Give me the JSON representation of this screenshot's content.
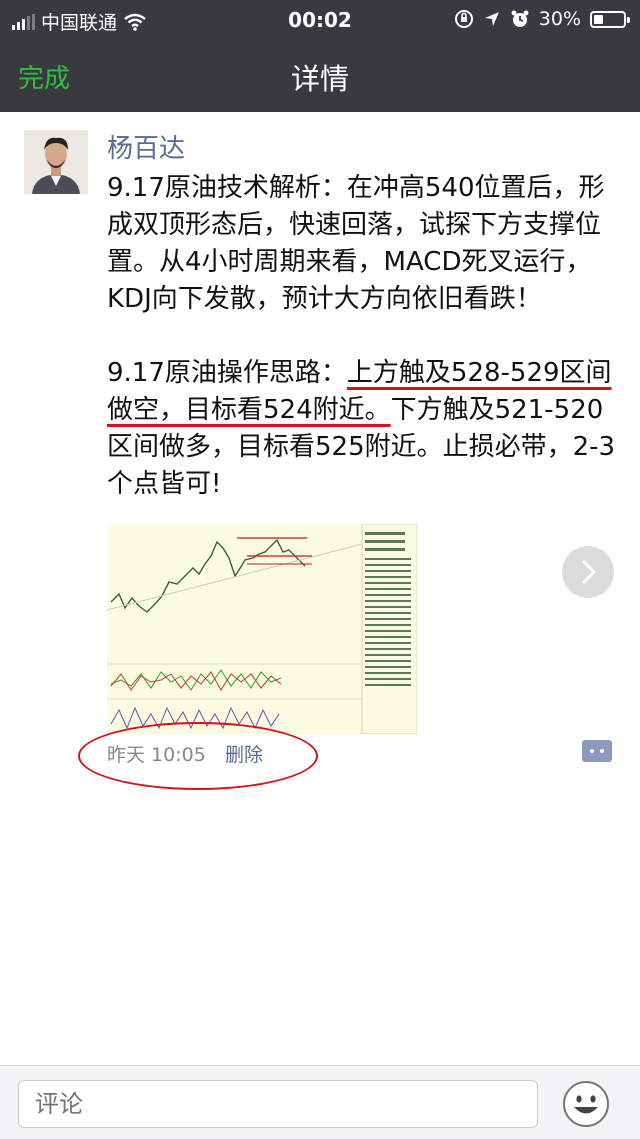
{
  "status_bar": {
    "carrier": "中国联通",
    "time": "00:02",
    "battery": "30%",
    "battery_level": 0.3
  },
  "nav": {
    "done_label": "完成",
    "title": "详情"
  },
  "post": {
    "author": "杨百达",
    "paragraph1": "9.17原油技术解析：在冲高540位置后，形成双顶形态后，快速回落，试探下方支撑位置。从4小时周期来看，MACD死叉运行，KDJ向下发散，预计大方向依旧看跌！",
    "paragraph2_prefix": "9.17原油操作思路：",
    "paragraph2_underlined": "上方触及528-529区间做空，目标看524附近。",
    "paragraph2_rest": "下方触及521-520区间做多，目标看525附近。止损必带，2-3个点皆可!",
    "timestamp": "昨天 10:05",
    "delete_label": "删除"
  },
  "comment_bar": {
    "placeholder": "评论"
  },
  "colors": {
    "nav_bg": "#393a3f",
    "done_green": "#2fbf3e",
    "link_blue": "#576b95",
    "annotation_red": "#d6121b"
  },
  "icons": [
    "signal-icon",
    "wifi-icon",
    "lock-rotation-icon",
    "location-icon",
    "alarm-icon",
    "battery-icon",
    "chevron-right-icon",
    "comment-icon",
    "emoji-icon"
  ]
}
